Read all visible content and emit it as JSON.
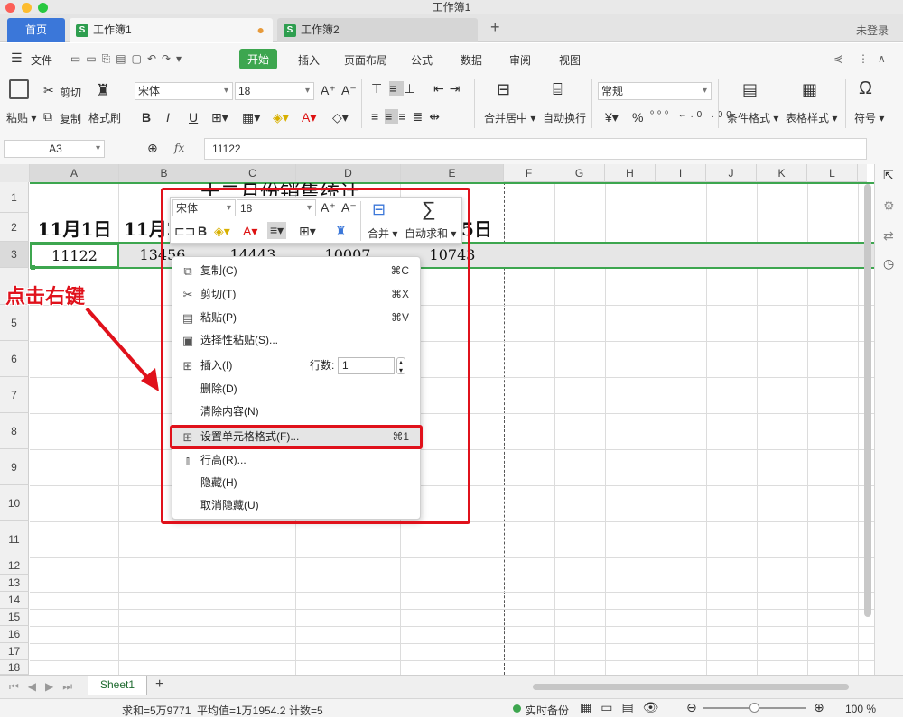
{
  "window": {
    "title": "工作簿1"
  },
  "tabs": {
    "home": "首页",
    "wb1": "工作簿1",
    "wb2": "工作簿2",
    "add": "+",
    "login": "未登录"
  },
  "menubar": {
    "file": "文件",
    "items": [
      "开始",
      "插入",
      "页面布局",
      "公式",
      "数据",
      "审阅",
      "视图"
    ]
  },
  "ribbon": {
    "paste": "粘贴",
    "cut": "剪切",
    "copy": "复制",
    "format_painter": "格式刷",
    "font_name": "宋体",
    "font_size": "18",
    "bold": "B",
    "italic": "I",
    "underline": "U",
    "merge_center": "合并居中",
    "wrap": "自动换行",
    "number_format": "常规",
    "percent": "%",
    "cond_format": "条件格式",
    "table_style": "表格样式",
    "symbol": "符号"
  },
  "formula_bar": {
    "cell_ref": "A3",
    "fx": "fx",
    "value": "11122"
  },
  "grid": {
    "columns": [
      "A",
      "B",
      "C",
      "D",
      "E",
      "F",
      "G",
      "H",
      "I",
      "J",
      "K",
      "L"
    ],
    "rows": [
      "1",
      "2",
      "3",
      "5",
      "6",
      "7",
      "8",
      "9",
      "10",
      "11",
      "12",
      "13",
      "14",
      "15",
      "16",
      "17",
      "18"
    ],
    "row1_partial": "十二月份销售统计",
    "row2": [
      "11月1日",
      "11月2",
      "5日"
    ],
    "row3": [
      "11122",
      "13456",
      "14443",
      "10007",
      "10743"
    ]
  },
  "annotation": {
    "text": "点击右键",
    "color": "#e0111b"
  },
  "mini_toolbar": {
    "font": "宋体",
    "size": "18",
    "bold": "B",
    "merge": "合并",
    "autosum": "自动求和"
  },
  "context_menu": {
    "items": [
      {
        "label": "复制(C)",
        "shortcut": "⌘C",
        "icon": "copy-icon"
      },
      {
        "label": "剪切(T)",
        "shortcut": "⌘X",
        "icon": "scissors-icon"
      },
      {
        "label": "粘贴(P)",
        "shortcut": "⌘V",
        "icon": "clipboard-icon"
      },
      {
        "label": "选择性粘贴(S)...",
        "shortcut": "",
        "icon": "paste-special-icon"
      },
      {
        "label": "插入(I)",
        "shortcut": "",
        "icon": "insert-icon"
      },
      {
        "label": "删除(D)",
        "shortcut": "",
        "icon": ""
      },
      {
        "label": "清除内容(N)",
        "shortcut": "",
        "icon": ""
      },
      {
        "label": "设置单元格格式(F)...",
        "shortcut": "⌘1",
        "icon": "format-cells-icon"
      },
      {
        "label": "行高(R)...",
        "shortcut": "",
        "icon": "row-height-icon"
      },
      {
        "label": "隐藏(H)",
        "shortcut": "",
        "icon": ""
      },
      {
        "label": "取消隐藏(U)",
        "shortcut": "",
        "icon": ""
      }
    ],
    "rows_label": "行数:",
    "rows_value": "1"
  },
  "sheets": {
    "active": "Sheet1",
    "add": "+"
  },
  "status": {
    "sum": "求和=5万9771",
    "avg": "平均值=1万1954.2",
    "count": "计数=5",
    "backup": "实时备份",
    "zoom": "100 %"
  }
}
